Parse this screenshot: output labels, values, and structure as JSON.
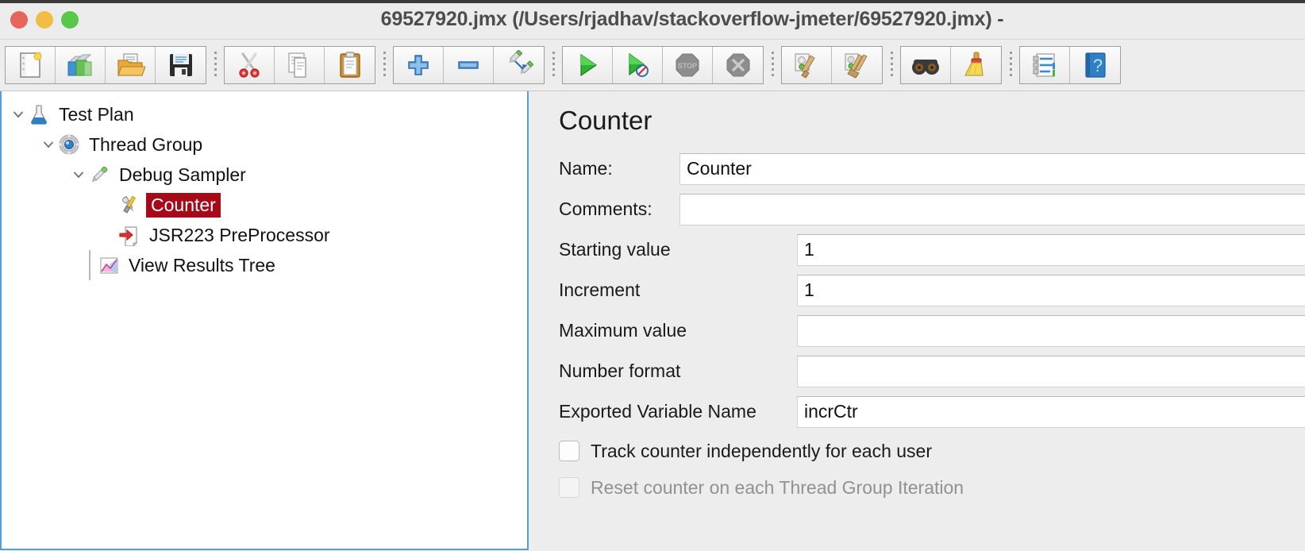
{
  "window": {
    "title": "69527920.jmx (/Users/rjadhav/stackoverflow-jmeter/69527920.jmx) -",
    "traffic": {
      "close": "close-button",
      "minimize": "minimize-button",
      "zoom": "zoom-button"
    }
  },
  "toolbar": {
    "groups": [
      {
        "buttons": [
          {
            "name": "new-icon",
            "label": "New"
          },
          {
            "name": "templates-icon",
            "label": "Templates"
          },
          {
            "name": "open-icon",
            "label": "Open"
          },
          {
            "name": "save-icon",
            "label": "Save"
          }
        ]
      },
      {
        "buttons": [
          {
            "name": "cut-icon",
            "label": "Cut"
          },
          {
            "name": "copy-icon",
            "label": "Copy"
          },
          {
            "name": "paste-icon",
            "label": "Paste"
          }
        ]
      },
      {
        "buttons": [
          {
            "name": "expand-all-icon",
            "label": "Expand All"
          },
          {
            "name": "collapse-all-icon",
            "label": "Collapse All"
          },
          {
            "name": "toggle-icon",
            "label": "Toggle"
          }
        ]
      },
      {
        "buttons": [
          {
            "name": "start-icon",
            "label": "Start"
          },
          {
            "name": "start-no-pauses-icon",
            "label": "Start no pauses"
          },
          {
            "name": "stop-icon",
            "label": "Stop"
          },
          {
            "name": "shutdown-icon",
            "label": "Shutdown"
          }
        ]
      },
      {
        "buttons": [
          {
            "name": "clear-icon",
            "label": "Clear"
          },
          {
            "name": "clear-all-icon",
            "label": "Clear All"
          }
        ]
      },
      {
        "buttons": [
          {
            "name": "search-icon",
            "label": "Search"
          },
          {
            "name": "reset-search-icon",
            "label": "Reset Search"
          }
        ]
      },
      {
        "buttons": [
          {
            "name": "function-helper-icon",
            "label": "Function Helper Dialog"
          },
          {
            "name": "help-icon",
            "label": "Help"
          }
        ]
      }
    ]
  },
  "tree": {
    "items": [
      {
        "label": "Test Plan",
        "icon": "test-plan-icon",
        "depth": 0,
        "twisty": "open",
        "selected": false
      },
      {
        "label": "Thread Group",
        "icon": "thread-group-icon",
        "depth": 1,
        "twisty": "open",
        "selected": false
      },
      {
        "label": "Debug Sampler",
        "icon": "debug-sampler-icon",
        "depth": 2,
        "twisty": "open",
        "selected": false
      },
      {
        "label": "Counter",
        "icon": "counter-icon",
        "depth": 3,
        "twisty": "none",
        "selected": true
      },
      {
        "label": "JSR223 PreProcessor",
        "icon": "preprocessor-icon",
        "depth": 3,
        "twisty": "none",
        "selected": false
      },
      {
        "label": "View Results Tree",
        "icon": "view-results-tree-icon",
        "depth": 2,
        "twisty": "none",
        "selected": false
      }
    ],
    "selection_color": "#a60a19",
    "focus_border_color": "#5a9fd4"
  },
  "form": {
    "title": "Counter",
    "fields": {
      "name_label": "Name:",
      "name_value": "Counter",
      "comments_label": "Comments:",
      "comments_value": "",
      "starting_value_label": "Starting value",
      "starting_value": "1",
      "increment_label": "Increment",
      "increment_value": "1",
      "maximum_value_label": "Maximum value",
      "maximum_value": "",
      "number_format_label": "Number format",
      "number_format_value": "",
      "exported_variable_label": "Exported Variable Name",
      "exported_variable_value": "incrCtr"
    },
    "checkboxes": [
      {
        "label": "Track counter independently for each user",
        "checked": false,
        "enabled": true
      },
      {
        "label": "Reset counter on each Thread Group Iteration",
        "checked": false,
        "enabled": false
      }
    ]
  }
}
